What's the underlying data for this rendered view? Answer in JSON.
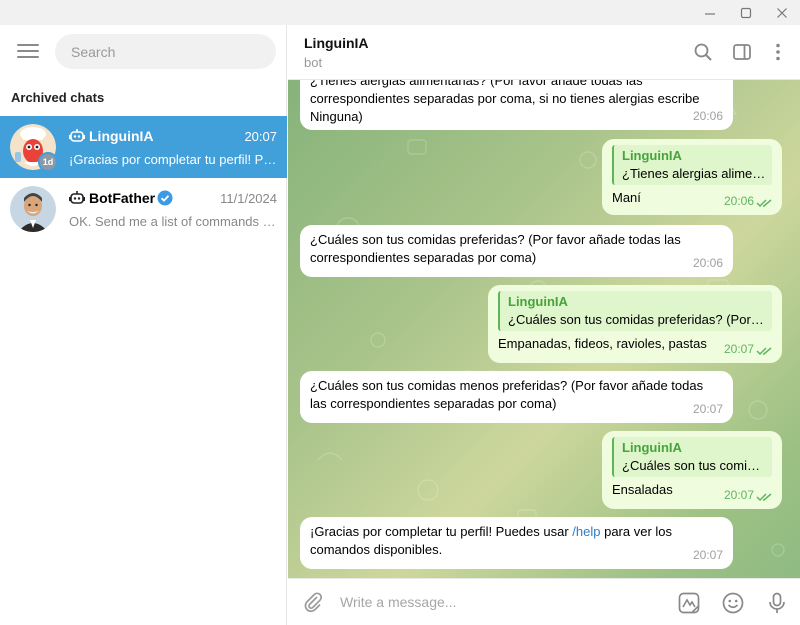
{
  "window": {
    "minimize_icon": "minimize-icon",
    "maximize_icon": "maximize-icon",
    "close_icon": "close-icon"
  },
  "sidebar": {
    "search_placeholder": "Search",
    "section_title": "Archived chats",
    "chats": [
      {
        "name": "LinguinIA",
        "time": "20:07",
        "preview": "¡Gracias por completar tu perfil! Puedes usar /help para ver los comandos disponibles.",
        "badge": "1d",
        "active": true
      },
      {
        "name": "BotFather",
        "time": "11/1/2024",
        "preview": "OK. Send me a list of commands for your bot.",
        "verified": true,
        "active": false
      }
    ]
  },
  "header": {
    "title": "LinguinIA",
    "subtitle": "bot"
  },
  "messages": [
    {
      "type": "in",
      "text": "¿Tienes alergias alimentarias? (Por favor añade todas las correspondientes separadas por coma, si no tienes alergias escribe Ninguna)",
      "time": "20:06"
    },
    {
      "type": "out",
      "reply_name": "LinguinIA",
      "reply_text": "¿Tienes alergias alimentarias? (Por favor añade todas las correspondientes separadas por coma, si no tienes alergias escribe Ninguna)",
      "text": "Maní",
      "time": "20:06"
    },
    {
      "type": "in",
      "text": "¿Cuáles son tus comidas preferidas? (Por favor añade todas las correspondientes separadas por coma)",
      "time": "20:06"
    },
    {
      "type": "out",
      "reply_name": "LinguinIA",
      "reply_text": "¿Cuáles son tus comidas preferidas? (Por favor añade todas las correspondientes separadas por coma)",
      "text": "Empanadas, fideos, ravioles, pastas",
      "time": "20:07"
    },
    {
      "type": "in",
      "text": "¿Cuáles son tus comidas menos preferidas? (Por favor añade todas las correspondientes separadas por coma)",
      "time": "20:07"
    },
    {
      "type": "out",
      "reply_name": "LinguinIA",
      "reply_text": "¿Cuáles son tus comidas menos preferidas? (Por favor añade todas las correspondientes separadas por coma)",
      "text": "Ensaladas",
      "time": "20:07"
    },
    {
      "type": "in",
      "text_before": "¡Gracias por completar tu perfil! Puedes usar ",
      "link": "/help",
      "text_after": " para ver los comandos disponibles.",
      "time": "20:07"
    }
  ],
  "composer": {
    "placeholder": "Write a message..."
  },
  "colors": {
    "accent": "#419fd9",
    "outgoing": "#effdde",
    "reply_accent": "#47a33c"
  }
}
